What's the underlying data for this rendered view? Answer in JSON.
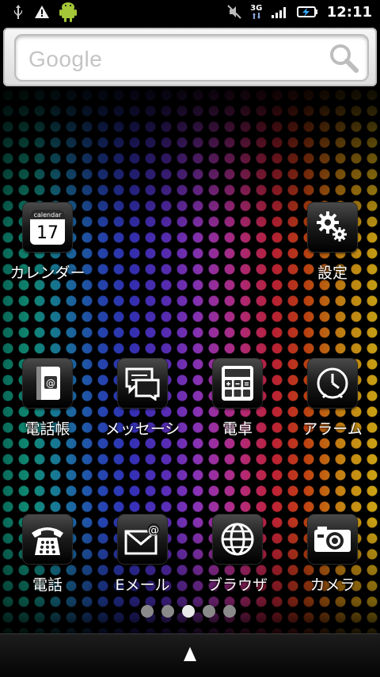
{
  "status_bar": {
    "left_icons": [
      "usb-icon",
      "warning-icon",
      "android-icon"
    ],
    "right_icons": [
      "mute-icon",
      "signal-3g-icon",
      "signal-bars-icon",
      "battery-charging-icon"
    ],
    "network_label": "3G",
    "time": "12:11"
  },
  "search_widget": {
    "logo_text": "Google",
    "icon": "search-icon"
  },
  "apps": {
    "calendar": {
      "label": "カレンダー",
      "icon_text": "calendar",
      "icon_day": "17"
    },
    "settings": {
      "label": "設定"
    },
    "contacts": {
      "label": "電話帳",
      "icon_text": "@"
    },
    "messages": {
      "label": "メッセーシ"
    },
    "calculator": {
      "label": "電卓"
    },
    "alarm": {
      "label": "アラーム"
    },
    "phone": {
      "label": "電話"
    },
    "email": {
      "label": "Eメール"
    },
    "browser": {
      "label": "ブラウザ"
    },
    "camera": {
      "label": "カメラ"
    }
  },
  "page_indicator": {
    "pages": 5,
    "current": 3
  },
  "drawer": {
    "icon": "chevron-up-icon"
  }
}
